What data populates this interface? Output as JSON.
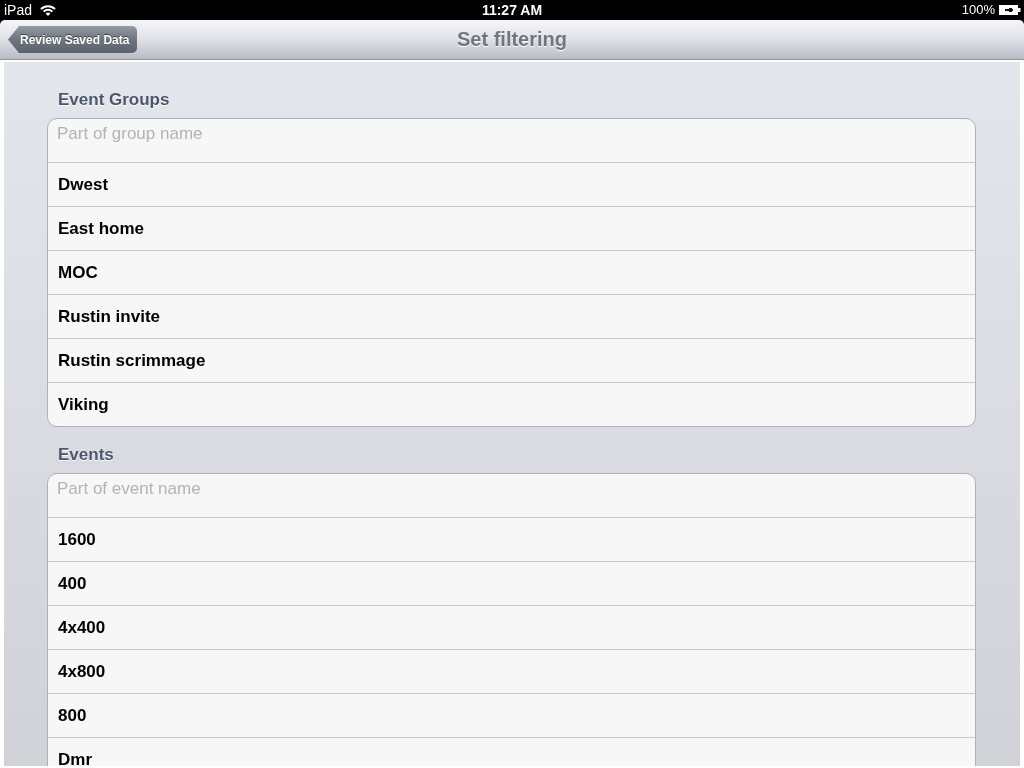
{
  "status_bar": {
    "device": "iPad",
    "time": "11:27 AM",
    "battery": "100%"
  },
  "nav_bar": {
    "back_button": "Review Saved Data",
    "title": "Set filtering"
  },
  "sections": [
    {
      "header": "Event Groups",
      "search": {
        "placeholder": "Part of group name"
      },
      "items": [
        "Dwest",
        "East home",
        "MOC",
        "Rustin invite",
        "Rustin scrimmage",
        "Viking"
      ]
    },
    {
      "header": "Events",
      "search": {
        "placeholder": "Part of event name"
      },
      "items": [
        "1600",
        "400",
        "4x400",
        "4x800",
        "800",
        "Dmr"
      ]
    }
  ]
}
